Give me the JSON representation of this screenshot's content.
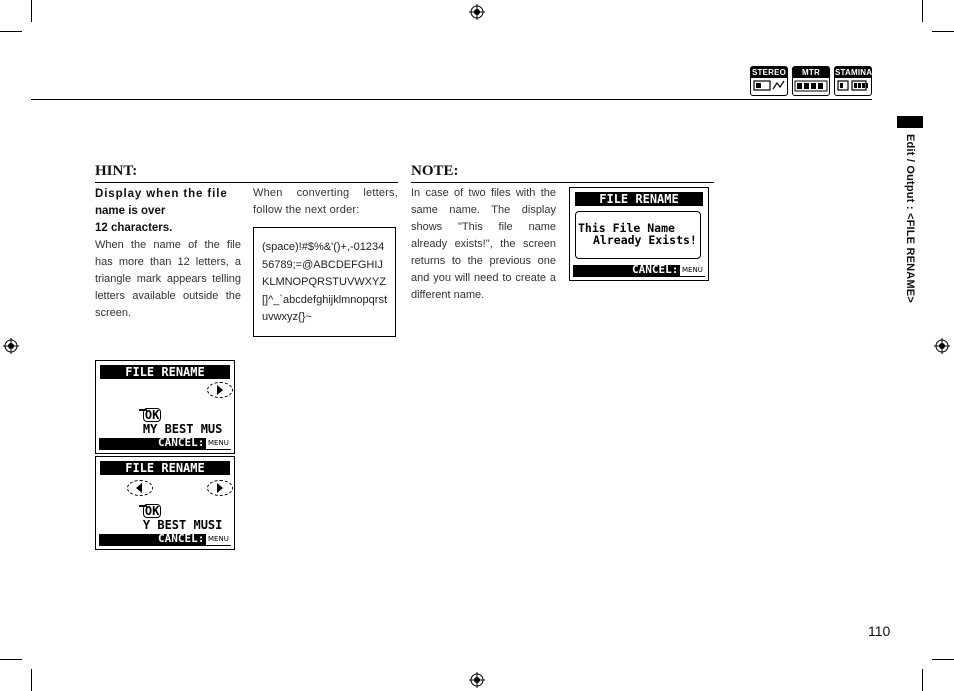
{
  "header": {
    "modes": [
      {
        "label": "STEREO",
        "icon": "stereo-mode-icon"
      },
      {
        "label": "MTR",
        "icon": "mtr-mode-icon"
      },
      {
        "label": "STAMINA",
        "icon": "stamina-mode-icon"
      }
    ]
  },
  "side_tab": {
    "text": "Edit / Output : <FILE RENAME>"
  },
  "hint": {
    "title": "HINT:",
    "heading_line1": "Display when the file",
    "heading_line2": "name is over",
    "heading_line3": "12 characters.",
    "body": "When the name of the file has more than 12 letters, a triangle mark appears telling letters available outside the screen.",
    "conversion_text": "When converting letters, follow the next order:",
    "char_order": "(space)!#$%&'()+,-0123456789;=@ABCDEFGHIJKLMNOPQRSTUVWXYZ[]^_`abcdefghijklmnopqrstuvwxyz{}~"
  },
  "note": {
    "title": "NOTE:",
    "body": "In case of two files with the same name. The display shows \"This file name already exists!\", the screen returns to the previous one and you will need to create a different name."
  },
  "screens": {
    "note_screen": {
      "title": "FILE RENAME",
      "line1": "This File Name",
      "line2": "Already Exists!",
      "cancel": "CANCEL:",
      "menu": "MENU"
    },
    "hint_screen1": {
      "title": "FILE RENAME",
      "ok": "OK",
      "name": "MY BEST MUS",
      "cancel": "CANCEL:",
      "menu": "MENU"
    },
    "hint_screen2": {
      "title": "FILE RENAME",
      "ok": "OK",
      "name": "Y BEST MUSI",
      "cancel": "CANCEL:",
      "menu": "MENU"
    }
  },
  "page_number": "110"
}
